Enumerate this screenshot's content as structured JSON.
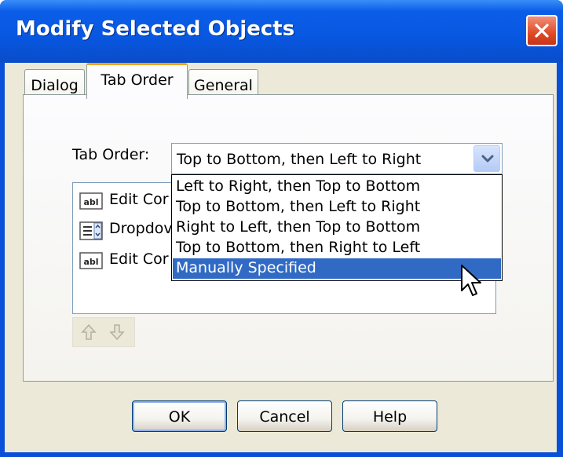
{
  "window": {
    "title": "Modify Selected Objects",
    "close_icon": "close-icon"
  },
  "tabs": [
    {
      "label": "Dialog",
      "active": false
    },
    {
      "label": "Tab Order",
      "active": true
    },
    {
      "label": "General",
      "active": false
    }
  ],
  "tab_order": {
    "label": "Tab Order:",
    "selected_value": "Top to Bottom, then Left to Right",
    "options": [
      "Left to Right, then Top to Bottom",
      "Top to Bottom, then Left to Right",
      "Right to Left, then Top to Bottom",
      "Top to Bottom, then Right to Left",
      "Manually Specified"
    ],
    "highlighted_option": "Manually Specified"
  },
  "object_list": [
    {
      "icon": "edit-control-icon",
      "label": "Edit Cor"
    },
    {
      "icon": "dropdown-control-icon",
      "label": "Dropdov"
    },
    {
      "icon": "edit-control-icon",
      "label": "Edit Cor"
    }
  ],
  "move_buttons": {
    "up_icon": "move-up-arrow-icon",
    "down_icon": "move-down-arrow-icon"
  },
  "buttons": {
    "ok": "OK",
    "cancel": "Cancel",
    "help": "Help"
  },
  "colors": {
    "titlebar": "#0a5ce6",
    "selection": "#316ac5",
    "active_tab_accent": "#f3a51b",
    "dialog_background": "#ece9d8"
  }
}
